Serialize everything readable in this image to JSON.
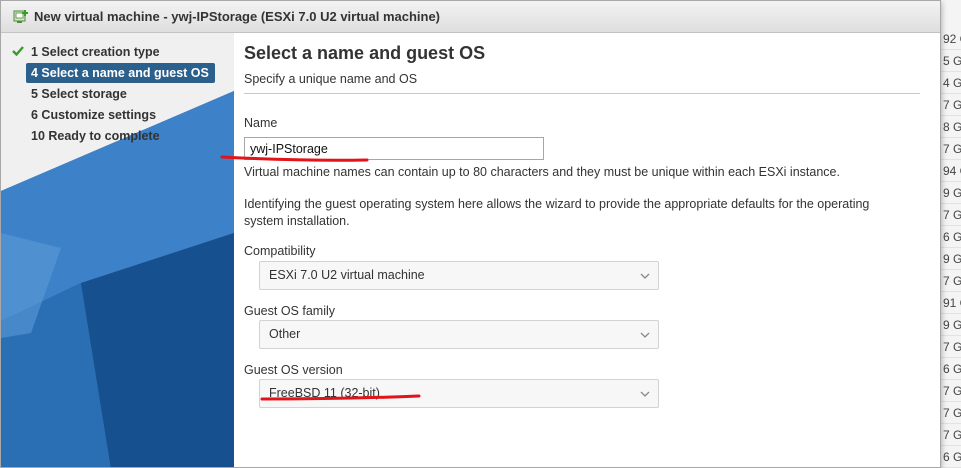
{
  "window": {
    "title": "New virtual machine - ywj-IPStorage (ESXi 7.0 U2 virtual machine)"
  },
  "nav": {
    "steps": [
      {
        "label": "1  Select creation type",
        "done": true
      },
      {
        "label": "4  Select a name and guest OS",
        "active": true
      },
      {
        "label": "5  Select storage"
      },
      {
        "label": "6  Customize settings"
      },
      {
        "label": "10  Ready to complete"
      }
    ]
  },
  "main": {
    "title": "Select a name and guest OS",
    "subtitle": "Specify a unique name and OS",
    "name_label": "Name",
    "name_value": "ywj-IPStorage",
    "name_help": "Virtual machine names can contain up to 80 characters and they must be unique within each ESXi instance.",
    "os_help": "Identifying the guest operating system here allows the wizard to provide the appropriate defaults for the operating system installation.",
    "compatibility_label": "Compatibility",
    "compatibility_value": "ESXi 7.0 U2 virtual machine",
    "os_family_label": "Guest OS family",
    "os_family_value": "Other",
    "os_version_label": "Guest OS version",
    "os_version_value": "FreeBSD 11 (32-bit)"
  },
  "background_list": {
    "rows": [
      "92 G",
      "5 G",
      "4 G",
      "7 G",
      "8 G",
      "7 G",
      "94 G",
      "9 G",
      "7 G",
      "6 G",
      "9 G",
      "7 G",
      "91 G",
      "9 G",
      "7 G",
      "6 G",
      "7 G",
      "7 G",
      "7 G",
      "6 G",
      "5 G"
    ]
  },
  "colors": {
    "active_step": "#2b5f8c",
    "check": "#3a9a2a",
    "annotation": "#e0141a"
  }
}
